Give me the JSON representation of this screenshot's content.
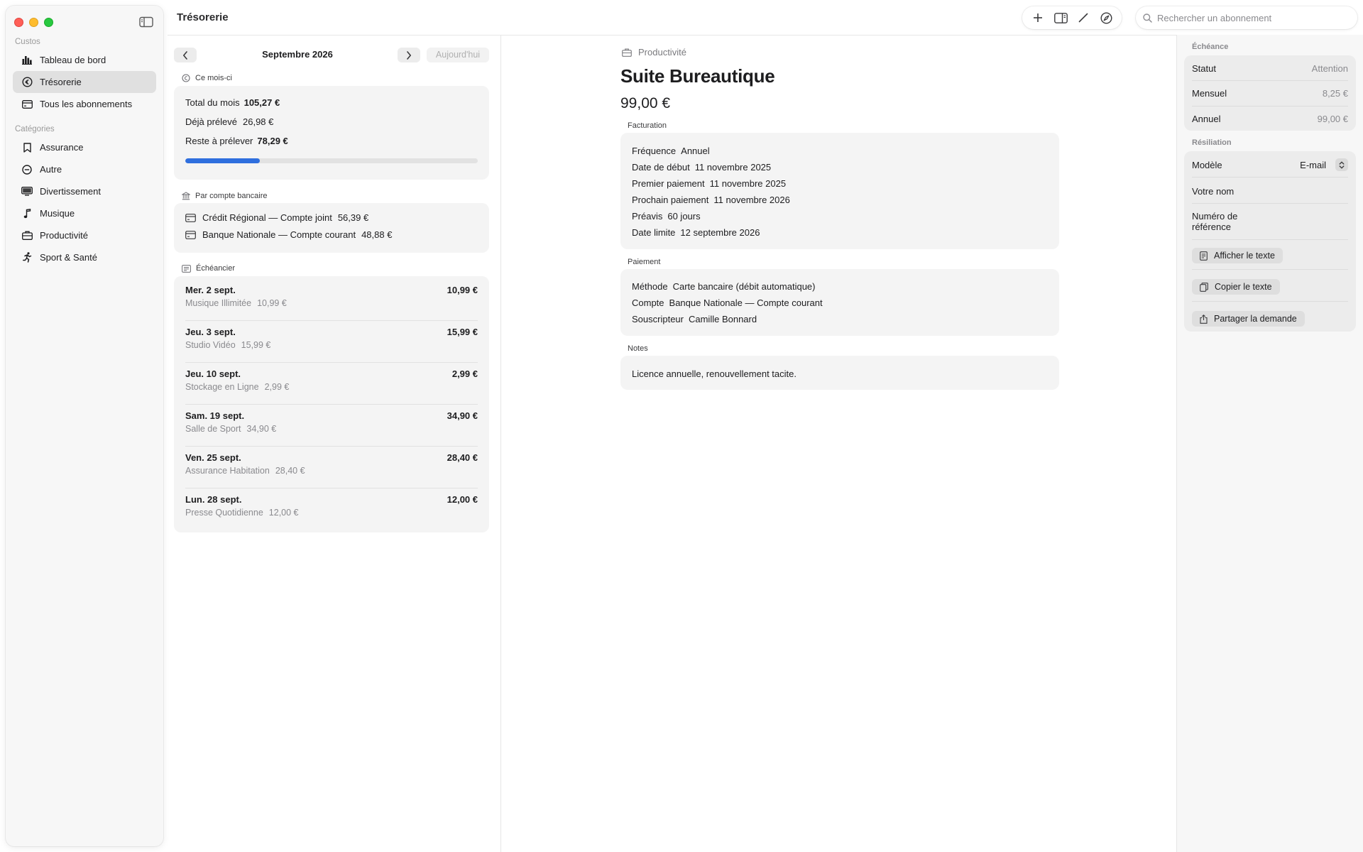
{
  "window": {
    "title": "Trésorerie"
  },
  "sidebar": {
    "section_main": "Custos",
    "main_items": [
      {
        "label": "Tableau de bord",
        "icon": "chart-bar-icon"
      },
      {
        "label": "Trésorerie",
        "icon": "clock-euro-icon",
        "active": true
      },
      {
        "label": "Tous les abonnements",
        "icon": "card-icon"
      }
    ],
    "section_categories": "Catégories",
    "categories": [
      {
        "label": "Assurance",
        "icon": "bookmark-icon"
      },
      {
        "label": "Autre",
        "icon": "minus-circle-icon"
      },
      {
        "label": "Divertissement",
        "icon": "display-icon"
      },
      {
        "label": "Musique",
        "icon": "music-note-icon"
      },
      {
        "label": "Productivité",
        "icon": "briefcase-icon"
      },
      {
        "label": "Sport & Santé",
        "icon": "running-figure-icon"
      }
    ]
  },
  "toolbar": {
    "buttons": [
      "plus-icon",
      "panel-icon",
      "pencil-icon",
      "compass-icon"
    ],
    "search_placeholder": "Rechercher un abonnement"
  },
  "calendar": {
    "month": "Septembre 2026",
    "today_label": "Aujourd'hui",
    "month_section": "Ce mois-ci",
    "summary": {
      "total_label": "Total du mois",
      "total_value": "105,27 €",
      "paid_label": "Déjà prélevé",
      "paid_value": "26,98 €",
      "remaining_label": "Reste à prélever",
      "remaining_value": "78,29 €",
      "progress_fraction": 0.256
    },
    "accounts_section": "Par compte bancaire",
    "accounts": [
      {
        "name": "Crédit Régional — Compte joint",
        "amount": "56,39 €"
      },
      {
        "name": "Banque Nationale — Compte courant",
        "amount": "48,88 €"
      }
    ],
    "schedule_section": "Échéancier",
    "schedule": [
      {
        "date": "Mer. 2 sept.",
        "amount": "10,99 €",
        "name": "Musique Illimitée",
        "sub_amount": "10,99 €"
      },
      {
        "date": "Jeu. 3 sept.",
        "amount": "15,99 €",
        "name": "Studio Vidéo",
        "sub_amount": "15,99 €"
      },
      {
        "date": "Jeu. 10 sept.",
        "amount": "2,99 €",
        "name": "Stockage en Ligne",
        "sub_amount": "2,99 €"
      },
      {
        "date": "Sam. 19 sept.",
        "amount": "34,90 €",
        "name": "Salle de Sport",
        "sub_amount": "34,90 €"
      },
      {
        "date": "Ven. 25 sept.",
        "amount": "28,40 €",
        "name": "Assurance Habitation",
        "sub_amount": "28,40 €"
      },
      {
        "date": "Lun. 28 sept.",
        "amount": "12,00 €",
        "name": "Presse Quotidienne",
        "sub_amount": "12,00 €"
      }
    ]
  },
  "detail": {
    "category": "Productivité",
    "title": "Suite Bureautique",
    "price": "99,00 €",
    "billing_label": "Facturation",
    "billing": [
      {
        "k": "Fréquence",
        "v": "Annuel"
      },
      {
        "k": "Date de début",
        "v": "11 novembre 2025"
      },
      {
        "k": "Premier paiement",
        "v": "11 novembre 2025"
      },
      {
        "k": "Prochain paiement",
        "v": "11 novembre 2026"
      },
      {
        "k": "Préavis",
        "v": "60 jours"
      },
      {
        "k": "Date limite",
        "v": "12 septembre 2026"
      }
    ],
    "payment_label": "Paiement",
    "payment": [
      {
        "k": "Méthode",
        "v": "Carte bancaire (débit automatique)"
      },
      {
        "k": "Compte",
        "v": "Banque Nationale — Compte courant"
      },
      {
        "k": "Souscripteur",
        "v": "Camille Bonnard"
      }
    ],
    "notes_label": "Notes",
    "notes": "Licence annuelle, renouvellement tacite."
  },
  "inspector": {
    "echeance_label": "Échéance",
    "status_label": "Statut",
    "status_value": "Attention",
    "monthly_label": "Mensuel",
    "monthly_value": "8,25 €",
    "annual_label": "Annuel",
    "annual_value": "99,00 €",
    "resiliation_label": "Résiliation",
    "model_label": "Modèle",
    "model_value": "E-mail",
    "name_label": "Votre nom",
    "ref_label_1": "Numéro de",
    "ref_label_2": "référence",
    "show_text": "Afficher le texte",
    "copy_text": "Copier le texte",
    "share_request": "Partager la demande"
  }
}
